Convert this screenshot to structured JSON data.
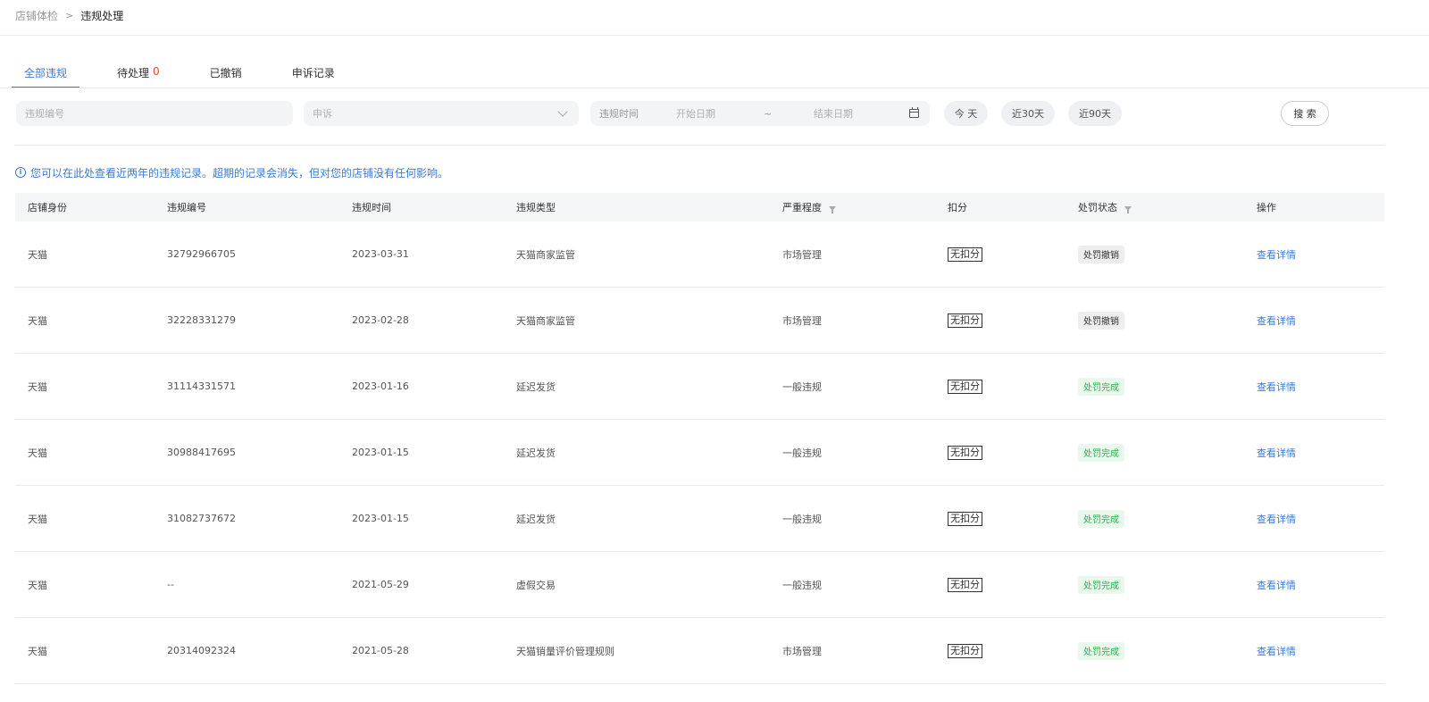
{
  "breadcrumb": {
    "parent": "店铺体检",
    "separator": ">",
    "current": "违规处理"
  },
  "tabs": [
    {
      "label": "全部违规",
      "count": "",
      "active": true
    },
    {
      "label": "待处理",
      "count": "0",
      "active": false
    },
    {
      "label": "已撤销",
      "count": "",
      "active": false
    },
    {
      "label": "申诉记录",
      "count": "",
      "active": false
    }
  ],
  "filters": {
    "code_placeholder": "违规编号",
    "status_value": "申诉",
    "date_label": "违规时间",
    "start_placeholder": "开始日期",
    "tilde": "~",
    "end_placeholder": "结束日期",
    "quick": [
      "今 天",
      "近30天",
      "近90天"
    ],
    "search_label": "搜 索"
  },
  "notice": "您可以在此处查看近两年的违规记录。超期的记录会消失，但对您的店铺没有任何影响。",
  "table": {
    "headers": [
      "店铺身份",
      "违规编号",
      "违规时间",
      "违规类型",
      "严重程度",
      "扣分",
      "处罚状态",
      "操作"
    ],
    "rows": [
      {
        "shop": "天猫",
        "code": "32792966705",
        "date": "2023-03-31",
        "type": "天猫商家监管",
        "severity": "市场管理",
        "deduct": "无扣分",
        "status": "处罚撤销",
        "status_kind": "revoked",
        "action": "查看详情"
      },
      {
        "shop": "天猫",
        "code": "32228331279",
        "date": "2023-02-28",
        "type": "天猫商家监管",
        "severity": "市场管理",
        "deduct": "无扣分",
        "status": "处罚撤销",
        "status_kind": "revoked",
        "action": "查看详情"
      },
      {
        "shop": "天猫",
        "code": "31114331571",
        "date": "2023-01-16",
        "type": "延迟发货",
        "severity": "一般违规",
        "deduct": "无扣分",
        "status": "处罚完成",
        "status_kind": "done",
        "action": "查看详情"
      },
      {
        "shop": "天猫",
        "code": "30988417695",
        "date": "2023-01-15",
        "type": "延迟发货",
        "severity": "一般违规",
        "deduct": "无扣分",
        "status": "处罚完成",
        "status_kind": "done",
        "action": "查看详情"
      },
      {
        "shop": "天猫",
        "code": "31082737672",
        "date": "2023-01-15",
        "type": "延迟发货",
        "severity": "一般违规",
        "deduct": "无扣分",
        "status": "处罚完成",
        "status_kind": "done",
        "action": "查看详情"
      },
      {
        "shop": "天猫",
        "code": "--",
        "date": "2021-05-29",
        "type": "虚假交易",
        "severity": "一般违规",
        "deduct": "无扣分",
        "status": "处罚完成",
        "status_kind": "done",
        "action": "查看详情"
      },
      {
        "shop": "天猫",
        "code": "20314092324",
        "date": "2021-05-28",
        "type": "天猫销量评价管理规则",
        "severity": "市场管理",
        "deduct": "无扣分",
        "status": "处罚完成",
        "status_kind": "done",
        "action": "查看详情"
      }
    ]
  }
}
